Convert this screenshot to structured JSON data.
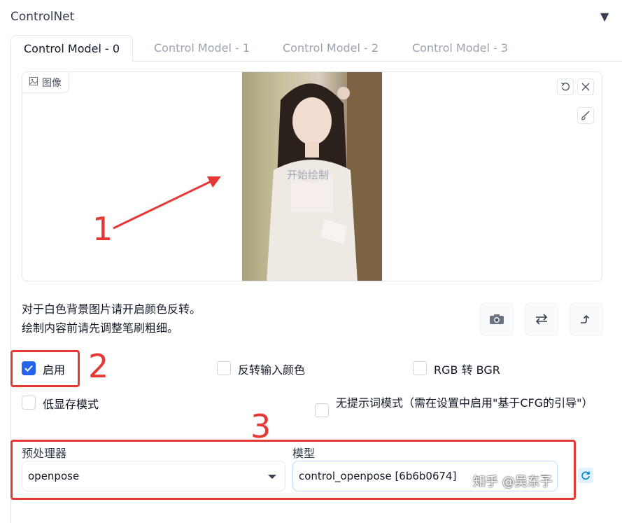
{
  "header": {
    "title": "ControlNet",
    "collapse_icon": "▼"
  },
  "tabs": [
    {
      "label": "Control Model - 0",
      "active": true
    },
    {
      "label": "Control Model - 1",
      "active": false
    },
    {
      "label": "Control Model - 2",
      "active": false
    },
    {
      "label": "Control Model - 3",
      "active": false
    }
  ],
  "image_panel": {
    "label": "图像",
    "overlay_text": "开始绘制",
    "tools": [
      "undo-icon",
      "close-icon",
      "brush-icon"
    ]
  },
  "hints": {
    "line1": "对于白色背景图片请开启颜色反转。",
    "line2": "绘制内容前请先调整笔刷粗细。"
  },
  "action_buttons": [
    "camera-icon",
    "swap-icon",
    "send-up-icon"
  ],
  "checkboxes": {
    "enable": {
      "label": "启用",
      "checked": true
    },
    "invert": {
      "label": "反转输入颜色",
      "checked": false
    },
    "rgb_bgr": {
      "label": "RGB 转 BGR",
      "checked": false
    },
    "lowvram": {
      "label": "低显存模式",
      "checked": false
    },
    "guess_mode": {
      "label": "无提示词模式（需在设置中启用\"基于CFG的引导\"）",
      "checked": false
    }
  },
  "preprocessor": {
    "label": "预处理器",
    "value": "openpose"
  },
  "model": {
    "label": "模型",
    "value": "control_openpose [6b6b0674]"
  },
  "annotations": {
    "marker1": "1",
    "marker2": "2",
    "marker3": "3"
  },
  "watermark": "知乎 @吴东子",
  "colors": {
    "accent": "#2563eb",
    "annotation_red": "#e53935",
    "border": "#e5e7eb"
  }
}
